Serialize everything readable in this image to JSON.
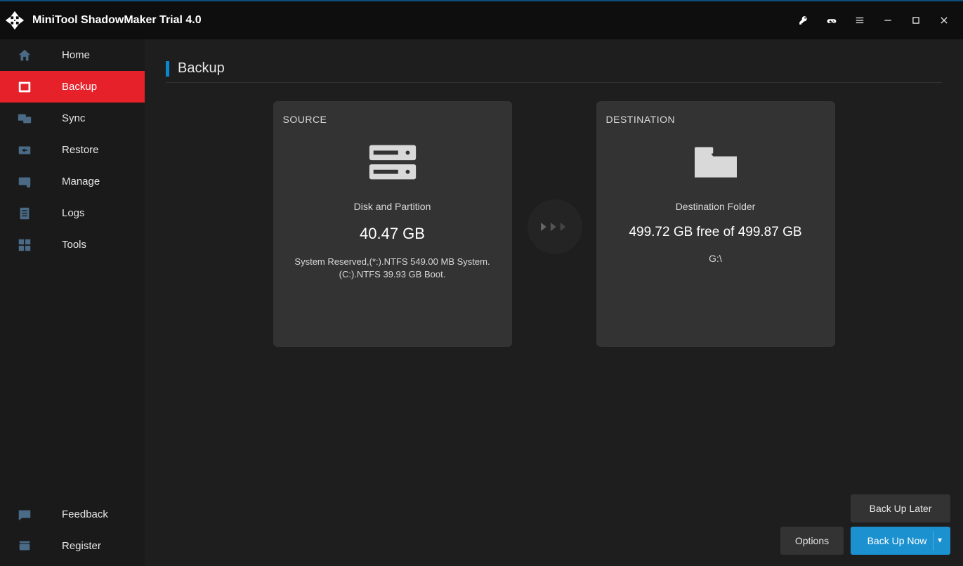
{
  "app": {
    "title": "MiniTool ShadowMaker Trial 4.0"
  },
  "titlebar_icons": {
    "key": "key-icon",
    "gamepad": "gamepad-icon",
    "menu": "menu-icon",
    "minimize": "minimize-icon",
    "maximize": "maximize-icon",
    "close": "close-icon"
  },
  "sidebar": {
    "items": [
      {
        "label": "Home",
        "icon": "home-icon",
        "active": false
      },
      {
        "label": "Backup",
        "icon": "backup-icon",
        "active": true
      },
      {
        "label": "Sync",
        "icon": "sync-icon",
        "active": false
      },
      {
        "label": "Restore",
        "icon": "restore-icon",
        "active": false
      },
      {
        "label": "Manage",
        "icon": "manage-icon",
        "active": false
      },
      {
        "label": "Logs",
        "icon": "logs-icon",
        "active": false
      },
      {
        "label": "Tools",
        "icon": "tools-icon",
        "active": false
      }
    ],
    "bottom": [
      {
        "label": "Feedback",
        "icon": "feedback-icon"
      },
      {
        "label": "Register",
        "icon": "register-icon"
      }
    ]
  },
  "page": {
    "title": "Backup"
  },
  "source": {
    "heading": "SOURCE",
    "type_label": "Disk and Partition",
    "size": "40.47 GB",
    "details": "System Reserved,(*:).NTFS 549.00 MB System.(C:).NTFS 39.93 GB Boot."
  },
  "destination": {
    "heading": "DESTINATION",
    "type_label": "Destination Folder",
    "free_line": "499.72 GB free of 499.87 GB",
    "path": "G:\\"
  },
  "actions": {
    "options": "Options",
    "later": "Back Up Later",
    "now": "Back Up Now"
  }
}
